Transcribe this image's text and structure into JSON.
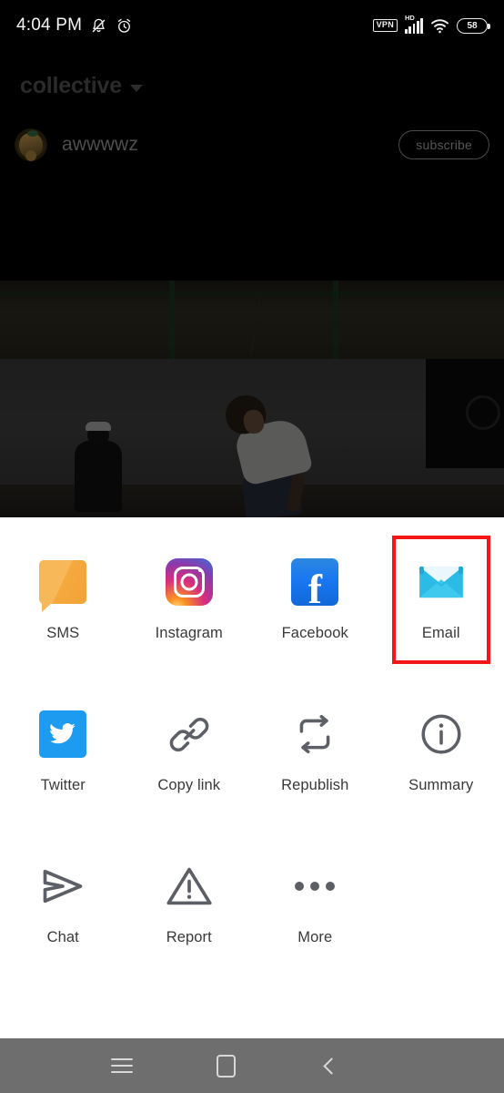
{
  "status_bar": {
    "time": "4:04 PM",
    "icons": [
      "mute-bell-icon",
      "alarm-clock-icon"
    ],
    "vpn_label": "VPN",
    "network_label": "HD",
    "signal_icon": "cellular-signal-icon",
    "wifi_icon": "wifi-icon",
    "battery_level": "58"
  },
  "app_header": {
    "title": "collective",
    "chevron_icon": "chevron-down-icon"
  },
  "video": {
    "channel_name": "awwwwz",
    "avatar_icon": "dog-avatar",
    "subscribe_label": "subscribe"
  },
  "share_sheet": {
    "rows": [
      [
        {
          "label": "SMS",
          "icon": "sms-message-icon",
          "highlighted": false
        },
        {
          "label": "Instagram",
          "icon": "instagram-icon",
          "highlighted": false
        },
        {
          "label": "Facebook",
          "icon": "facebook-icon",
          "highlighted": false
        },
        {
          "label": "Email",
          "icon": "email-envelope-icon",
          "highlighted": true
        }
      ],
      [
        {
          "label": "Twitter",
          "icon": "twitter-bird-icon",
          "highlighted": false
        },
        {
          "label": "Copy link",
          "icon": "link-chain-icon",
          "highlighted": false
        },
        {
          "label": "Republish",
          "icon": "repeat-arrows-icon",
          "highlighted": false
        },
        {
          "label": "Summary",
          "icon": "info-circle-icon",
          "highlighted": false
        }
      ],
      [
        {
          "label": "Chat",
          "icon": "send-plane-icon",
          "highlighted": false
        },
        {
          "label": "Report",
          "icon": "warning-triangle-icon",
          "highlighted": false
        },
        {
          "label": "More",
          "icon": "more-dots-icon",
          "highlighted": false
        }
      ]
    ]
  },
  "nav_bar": {
    "recents_icon": "menu-recents-icon",
    "home_icon": "home-square-icon",
    "back_icon": "back-chevron-icon"
  },
  "colors": {
    "highlight": "#f41616",
    "sheet_bg": "#ffffff",
    "facebook_blue": "#1877f2",
    "twitter_blue": "#1d9bf0",
    "email_cyan": "#29b6e8",
    "sms_orange": "#f6b858",
    "nav_bg": "#6e6e6e"
  }
}
